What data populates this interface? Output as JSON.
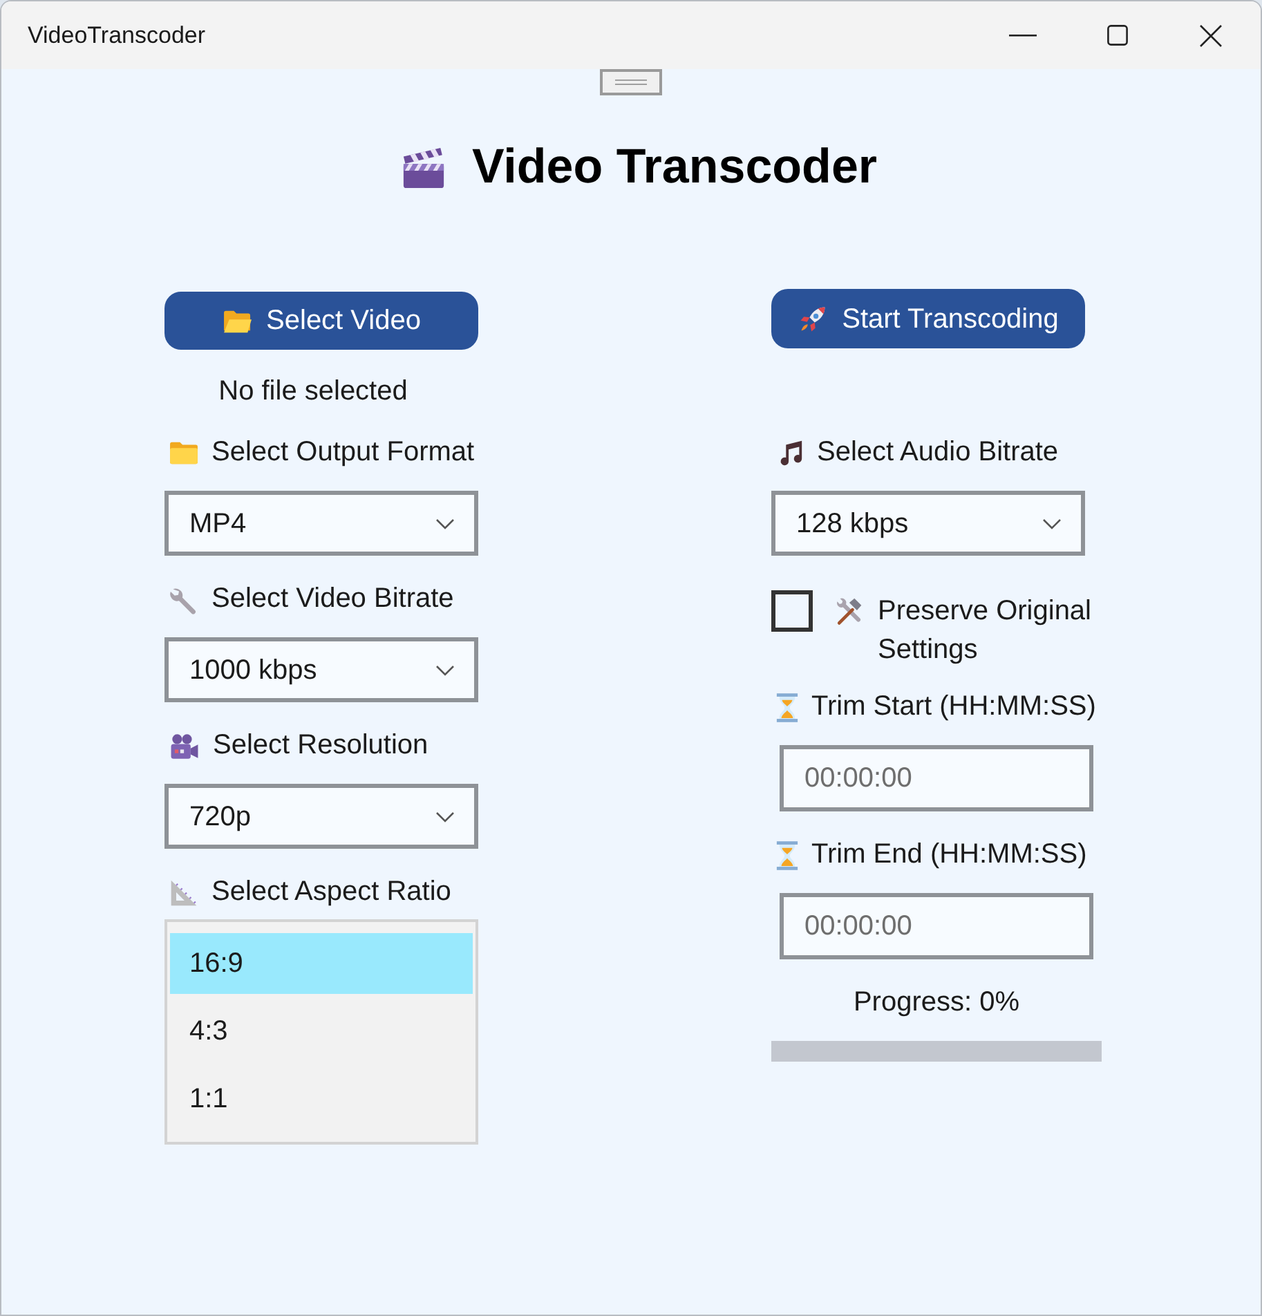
{
  "window": {
    "title": "VideoTranscoder"
  },
  "heading": {
    "text": "Video Transcoder"
  },
  "left_panel": {
    "button": {
      "label": "Select Video"
    },
    "file_status": "No file selected",
    "fields": [
      {
        "kind": "combobox",
        "label": "Select Output Format",
        "value": "MP4"
      },
      {
        "kind": "combobox",
        "label": "Select Video Bitrate",
        "value": "1000 kbps"
      },
      {
        "kind": "combobox",
        "label": "Select Resolution",
        "value": "720p"
      },
      {
        "kind": "listbox",
        "label": "Select Aspect Ratio",
        "options": [
          {
            "label": "16:9",
            "selected": true
          },
          {
            "label": "4:3",
            "selected": false
          },
          {
            "label": "1:1",
            "selected": false
          }
        ]
      }
    ]
  },
  "right_panel": {
    "button": {
      "label": "Start Transcoding"
    },
    "fields": [
      {
        "kind": "combobox",
        "label": "Select Audio Bitrate",
        "value": "128 kbps"
      },
      {
        "kind": "checkbox",
        "label": "Preserve Original Settings",
        "checked": false
      },
      {
        "kind": "textbox",
        "label": "Trim Start (HH:MM:SS)",
        "placeholder": "00:00:00"
      },
      {
        "kind": "textbox",
        "label": "Trim End (HH:MM:SS)",
        "placeholder": "00:00:00"
      }
    ],
    "progress": {
      "label": "Progress: 0%",
      "level": 0
    }
  }
}
